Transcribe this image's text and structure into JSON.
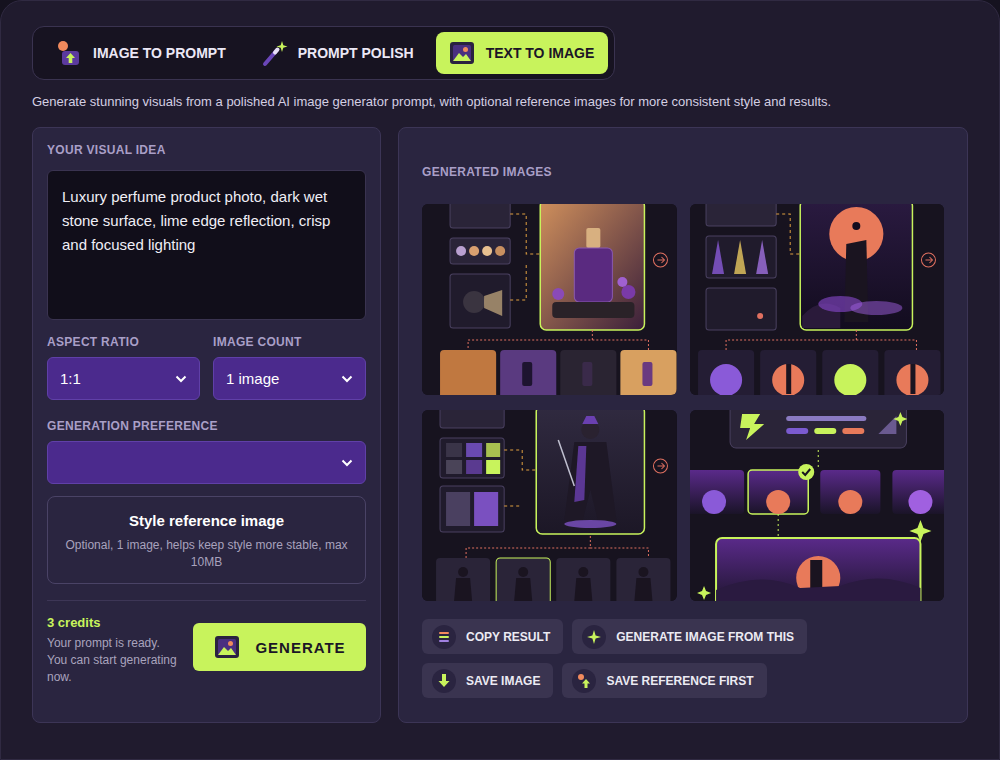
{
  "tabs": [
    {
      "label": "IMAGE TO PROMPT",
      "selected": false
    },
    {
      "label": "PROMPT POLISH",
      "selected": false
    },
    {
      "label": "TEXT TO IMAGE",
      "selected": true
    }
  ],
  "subtitle": "Generate stunning visuals from a polished AI image generator prompt, with optional reference images for more consistent style and results.",
  "idea": {
    "label": "YOUR VISUAL IDEA",
    "value": "Luxury perfume product photo, dark wet stone surface, lime edge reflection, crisp and focused lighting"
  },
  "aspect_ratio": {
    "label": "ASPECT RATIO",
    "value": "1:1"
  },
  "image_count": {
    "label": "IMAGE COUNT",
    "value": "1 image"
  },
  "generation_preference": {
    "label": "GENERATION PREFERENCE",
    "value": ""
  },
  "style_reference": {
    "title": "Style reference image",
    "hint": "Optional, 1 image, helps keep style more stable, max 10MB"
  },
  "credits": {
    "count": "3 credits",
    "message": "Your prompt is ready. You can start generating now."
  },
  "generate_button": "GENERATE",
  "results": {
    "label": "GENERATED IMAGES",
    "images": [
      {
        "kind": "perfume"
      },
      {
        "kind": "monolith"
      },
      {
        "kind": "warrior"
      },
      {
        "kind": "flow"
      }
    ]
  },
  "actions": [
    "COPY RESULT",
    "GENERATE IMAGE FROM THIS",
    "SAVE IMAGE",
    "SAVE REFERENCE FIRST"
  ]
}
